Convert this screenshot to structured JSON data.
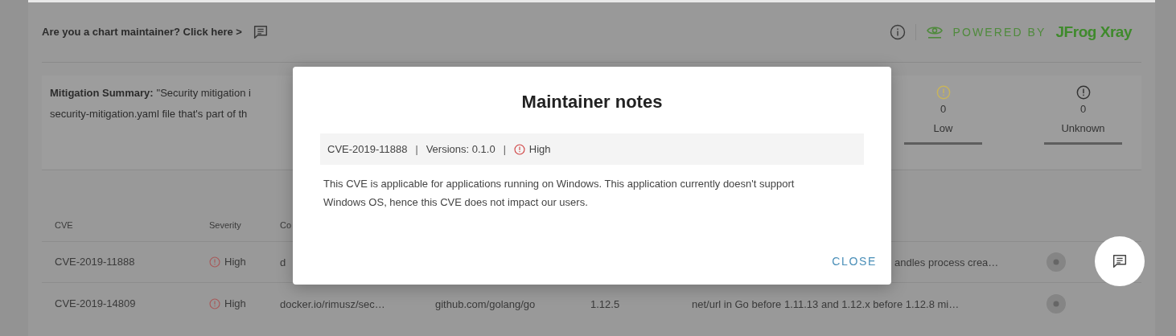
{
  "banner": {
    "prompt": "Are you a chart maintainer? Click here >"
  },
  "info_bar": {
    "powered_by": "POWERED BY",
    "brand": "JFrog Xray"
  },
  "summary": {
    "label": "Mitigation Summary:",
    "lines": [
      "\"Security mitigation i",
      "security-mitigation.yaml file that's part of th"
    ],
    "counters": [
      {
        "count": "0",
        "label": "Low",
        "color": "#c8b45c"
      },
      {
        "count": "0",
        "label": "Unknown",
        "color": "#333333"
      }
    ]
  },
  "table": {
    "columns": [
      "CVE",
      "Severity",
      "Co"
    ],
    "rows": [
      {
        "cve": "CVE-2019-11888",
        "severity": "High",
        "column_3": "d",
        "column_6": "andles process crea…"
      },
      {
        "cve": "CVE-2019-14809",
        "severity": "High",
        "column_3": "docker.io/rimusz/sec…",
        "column_4": "github.com/golang/go",
        "column_5": "1.12.5",
        "column_6": "net/url in Go before 1.11.13 and 1.12.x before 1.12.8 mi…"
      }
    ]
  },
  "modal": {
    "title": "Maintainer notes",
    "meta": [
      {
        "kind": "text",
        "text": "CVE-2019-11888"
      },
      {
        "kind": "separator",
        "text": "|"
      },
      {
        "kind": "text",
        "text": "Versions: 0.1.0"
      },
      {
        "kind": "separator",
        "text": "|"
      },
      {
        "kind": "severity",
        "text": "High"
      }
    ],
    "body": "This CVE is applicable for applications running on Windows. This application currently doesn't support Windows OS, hence this CVE does not impact our users.",
    "close_button": "CLOSE"
  }
}
